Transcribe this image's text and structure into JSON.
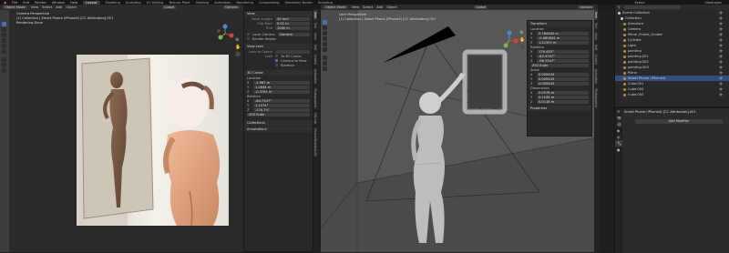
{
  "top_menu": {
    "items": [
      "File",
      "Edit",
      "Render",
      "Window",
      "Help"
    ],
    "workspaces": [
      "Layout",
      "Modeling",
      "Sculpting",
      "UV Editing",
      "Texture Paint",
      "Shading",
      "Animation",
      "Rendering",
      "Compositing",
      "Geometry Nodes",
      "Scripting"
    ],
    "active_workspace": "Layout",
    "scene": "Scene",
    "view_layer": "ViewLayer"
  },
  "left_viewport": {
    "mode": "Object Mode",
    "menus": [
      "View",
      "Select",
      "Add",
      "Object"
    ],
    "shading": "Global",
    "overlay_title": "Camera Perspective",
    "overlay_subtitle": "(1) Collection | Smart Phone (iPhone4) [CC Attribution].001",
    "overlay_status": "Rendering Done",
    "options": "Options"
  },
  "left_sidebar": {
    "view_panel": "View",
    "focal_length_label": "Focal Length",
    "focal_length": "50 mm",
    "clip_start_label": "Clip Start",
    "clip_start": "0.01 m",
    "clip_end_label": "End",
    "clip_end": "1000 m",
    "local_camera_label": "Local Camera",
    "camera_value": "Camera",
    "render_region_label": "Render Region",
    "view_lock_panel": "View Lock",
    "lock_to_object_label": "Lock to Object",
    "lock_label": "Lock",
    "lock_3d_cursor": "To 3D Cursor",
    "camera_to_view": "Camera to View",
    "rotation_lock": "Rotation",
    "cursor_panel": "3D Cursor",
    "location_label": "Location",
    "cursor_loc": [
      "-1.967 m",
      "1.2844 m",
      "-0.3761 m"
    ],
    "rotation_label": "Rotation",
    "cursor_rot": [
      "-64.7347°",
      "1.1574°",
      "-174.74°"
    ],
    "mode_value": "XYZ Euler",
    "collections_panel": "Collections",
    "annotations_panel": "Annotations"
  },
  "side_tabs_left": [
    "Item",
    "Tool",
    "View",
    "Edit",
    "Create",
    "Animation",
    "Photographer",
    "MB-Lab",
    "ManuelBastioniLAB"
  ],
  "right_viewport": {
    "mode": "Object Mode",
    "menus": [
      "View",
      "Select",
      "Add",
      "Object"
    ],
    "shading": "Global",
    "overlay_title": "User Perspective",
    "overlay_subtitle": "(1) Collection | Smart Phone (iPhone4) [CC Attribution].001",
    "options": "Options"
  },
  "transform_panel": {
    "title": "Transform",
    "location_label": "Location",
    "loc": [
      "0.764483 m",
      "-0.480844 m",
      "1.21397 m"
    ],
    "rotation_label": "Rotation",
    "rot": [
      "176.435°",
      "-62.3747°",
      "-96.7347°"
    ],
    "mode_value": "XYZ Euler",
    "scale_label": "Scale",
    "scale": [
      "0.009443",
      "0.009443",
      "0.009443"
    ],
    "dimensions_label": "Dimensions",
    "dims": [
      "0.0578 m",
      "0.1145 m",
      "0.0118 m"
    ],
    "properties_label": "Properties"
  },
  "side_tabs_right": [
    "Item",
    "Tool",
    "View",
    "Edit",
    "Create",
    "Animation",
    "Photographer"
  ],
  "outliner": {
    "items": [
      {
        "name": "Scene Collection",
        "color": "#cfcfcf"
      },
      {
        "name": "Collection",
        "color": "#cfcfcf"
      },
      {
        "name": "Armature",
        "color": "#c08a3e"
      },
      {
        "name": "Camera",
        "color": "#7ba05b"
      },
      {
        "name": "Mirror_Frame_Ornate",
        "color": "#c08a3e"
      },
      {
        "name": "Cylinder",
        "color": "#c08a3e"
      },
      {
        "name": "Light",
        "color": "#c08a3e"
      },
      {
        "name": "painting",
        "color": "#c08a3e"
      },
      {
        "name": "painting.001",
        "color": "#c08a3e"
      },
      {
        "name": "painting.002",
        "color": "#c08a3e"
      },
      {
        "name": "painting.003",
        "color": "#c08a3e"
      },
      {
        "name": "Plane",
        "color": "#c08a3e"
      },
      {
        "name": "Smart Phone (iPhone4)",
        "color": "#c08a3e"
      },
      {
        "name": "Cube.001",
        "color": "#c08a3e"
      },
      {
        "name": "Cube.002",
        "color": "#c08a3e"
      },
      {
        "name": "Cube.003",
        "color": "#c08a3e"
      }
    ],
    "selected_index": 12
  },
  "properties_editor": {
    "object_name": "Smart Phone (iPhone4) [CC Attribution].001",
    "add_modifier": "Add Modifier"
  },
  "colors": {
    "accent": "#4772b3",
    "selection": "#334d80",
    "x_axis": "#d9413f",
    "y_axis": "#7eb34d",
    "z_axis": "#4f86d8"
  }
}
